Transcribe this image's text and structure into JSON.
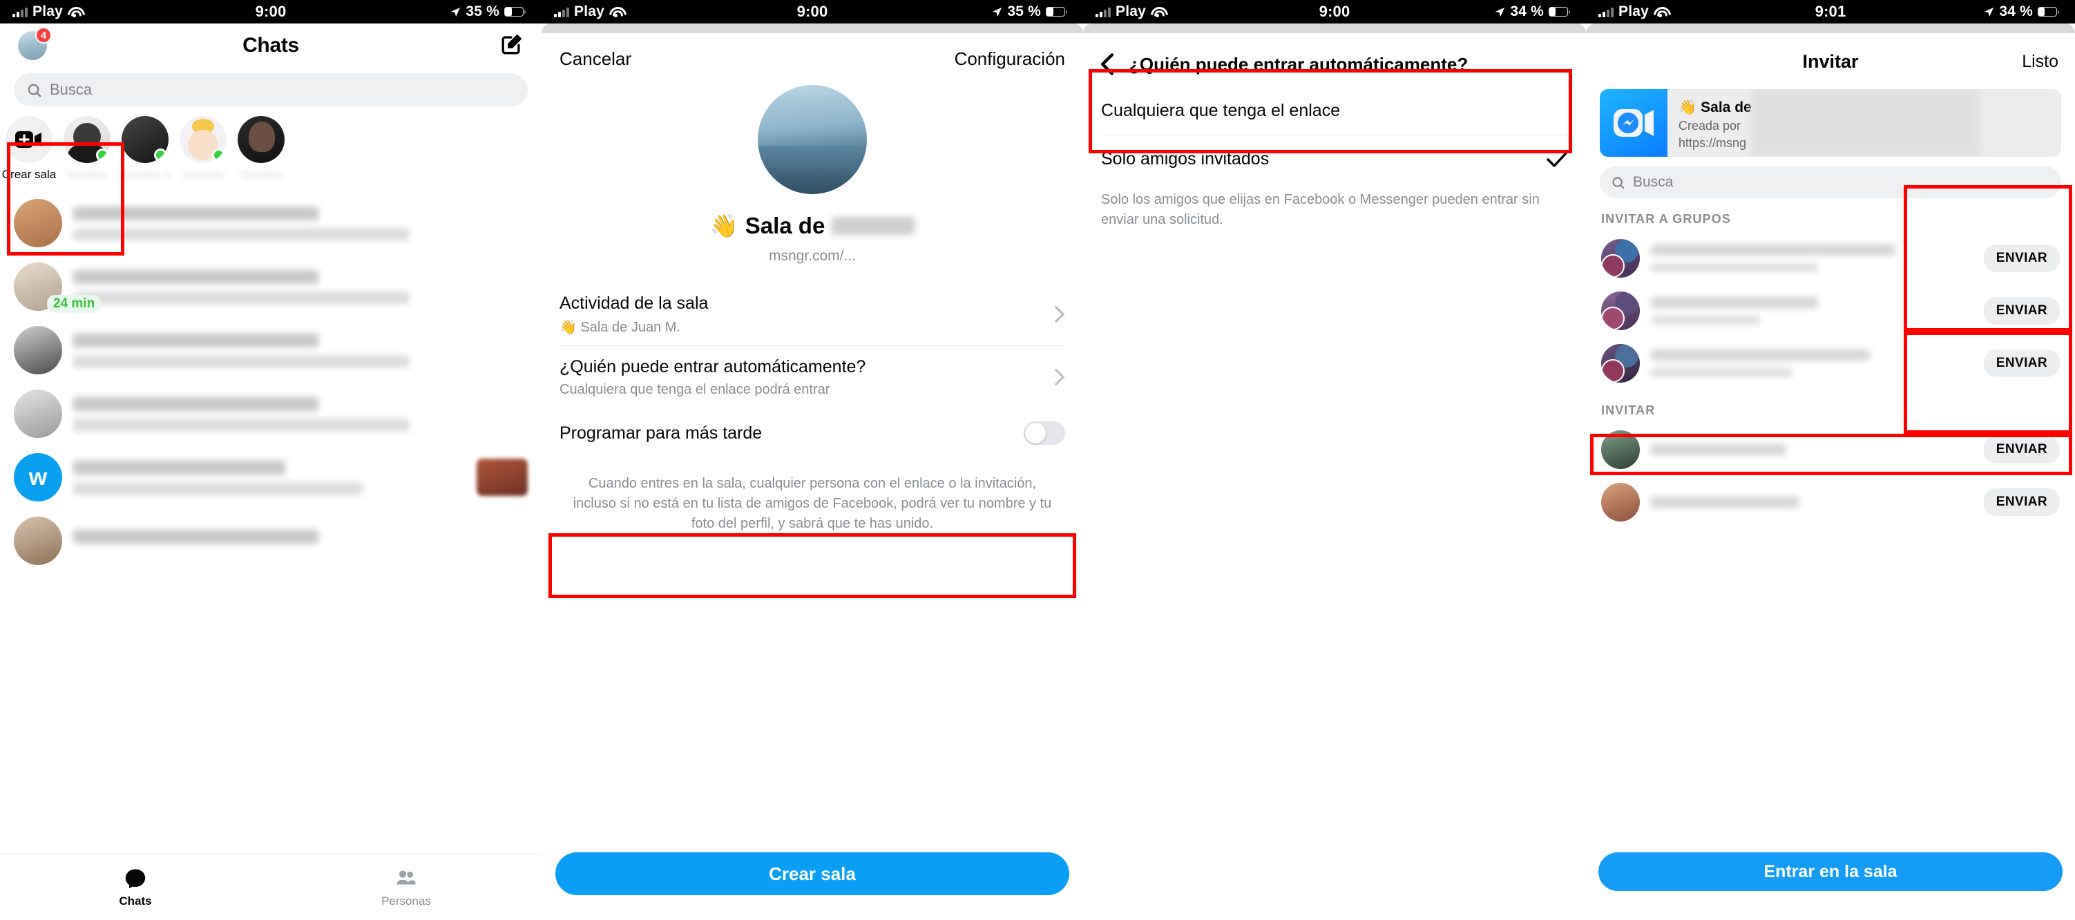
{
  "status_bars": [
    {
      "carrier": "Play",
      "time": "9:00",
      "battery": "35 %"
    },
    {
      "carrier": "Play",
      "time": "9:00",
      "battery": "35 %"
    },
    {
      "carrier": "Play",
      "time": "9:00",
      "battery": "34 %"
    },
    {
      "carrier": "Play",
      "time": "9:01",
      "battery": "34 %"
    }
  ],
  "panel1": {
    "title": "Chats",
    "avatar_badge": "4",
    "compose_icon": "compose-icon",
    "search": {
      "placeholder": "Busca",
      "icon": "search-icon"
    },
    "stories": [
      {
        "label": "Crear sala",
        "icon": "video-plus-icon",
        "online": false,
        "blurred": false
      },
      {
        "label": "",
        "online": true,
        "blurred": true
      },
      {
        "label": "",
        "online": true,
        "blurred": true
      },
      {
        "label": "",
        "online": true,
        "blurred": true
      },
      {
        "label": "",
        "online": false,
        "blurred": true
      }
    ],
    "chats": [
      {
        "time_badge": "",
        "blurred": true
      },
      {
        "time_badge": "24 min",
        "blurred": true
      },
      {
        "time_badge": "",
        "blurred": true
      },
      {
        "time_badge": "",
        "blurred": true
      },
      {
        "time_badge": "",
        "blurred": true
      }
    ],
    "tabs": [
      {
        "label": "Chats",
        "icon": "chat-bubble-icon",
        "active": true
      },
      {
        "label": "Personas",
        "icon": "people-icon",
        "active": false
      }
    ]
  },
  "panel2": {
    "cancel_label": "Cancelar",
    "settings_label": "Configuración",
    "room_title_prefix": "Sala de",
    "room_title_emoji": "👋",
    "room_url": "msngr.com/...",
    "rows": [
      {
        "title": "Actividad de la sala",
        "subtitle": "👋 Sala de Juan M."
      },
      {
        "title": "¿Quién puede entrar automáticamente?",
        "subtitle": "Cualquiera que tenga el enlace podrá entrar"
      }
    ],
    "schedule": {
      "label": "Programar para más tarde",
      "on": false
    },
    "disclaimer": "Cuando entres en la sala, cualquier persona con el enlace o la invitación, incluso si no está en tu lista de amigos de Facebook, podrá ver tu nombre y tu foto del perfil, y sabrá que te has unido.",
    "cta_label": "Crear sala"
  },
  "panel3": {
    "back_icon": "chevron-left-icon",
    "title": "¿Quién puede entrar automáticamente?",
    "options": [
      {
        "label": "Cualquiera que tenga el enlace",
        "checked": false
      },
      {
        "label": "Solo amigos invitados",
        "checked": true
      }
    ],
    "help": "Solo los amigos que elijas en Facebook o Messenger pueden entrar sin enviar una solicitud."
  },
  "panel4": {
    "title": "Invitar",
    "done_label": "Listo",
    "link_card": {
      "icon": "messenger-rooms-icon",
      "title_emoji": "👋",
      "title": "Sala de",
      "creator_line": "Creada por ",
      "url_line": "https://msng"
    },
    "search": {
      "placeholder": "Busca",
      "icon": "search-icon"
    },
    "section_groups": "INVITAR A GRUPOS",
    "section_people": "INVITAR",
    "send_label": "ENVIAR",
    "groups": [
      {
        "blurred": true,
        "send": "ENVIAR"
      },
      {
        "blurred": true,
        "send": "ENVIAR"
      },
      {
        "blurred": true,
        "send": "ENVIAR"
      }
    ],
    "people": [
      {
        "blurred": true,
        "send": "ENVIAR"
      },
      {
        "blurred": true,
        "send": "ENVIAR"
      }
    ],
    "cta_label": "Entrar en la sala"
  },
  "colors": {
    "accent": "#0a9ff5",
    "cta_blue": "#149cf7",
    "annotation_red": "#ff0000",
    "online_green": "#31d43c",
    "badge_red": "#fa3e3e"
  }
}
